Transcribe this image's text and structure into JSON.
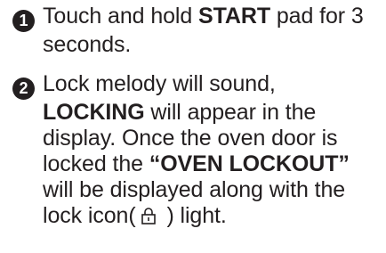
{
  "steps": [
    {
      "number": "1",
      "lines": [
        [
          "Touch and hold ",
          "START",
          " pad for 3"
        ],
        [
          "seconds."
        ]
      ]
    },
    {
      "number": "2",
      "lines": [
        [
          "Lock melody will sound,"
        ],
        [
          "LOCKING",
          " will appear in the"
        ],
        [
          "display. Once the oven door is"
        ],
        [
          "locked the ",
          "“OVEN LOCKOUT”"
        ],
        [
          "will be displayed along with the"
        ],
        [
          "lock icon(",
          " ) light."
        ]
      ]
    }
  ],
  "icons": {
    "lock_icon": "lock-icon",
    "step_badge": "filled-circle-number"
  },
  "colors": {
    "text": "#231f20",
    "background": "#ffffff"
  }
}
